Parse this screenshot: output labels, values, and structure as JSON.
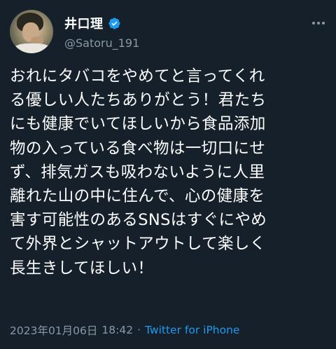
{
  "author": {
    "display_name": "井口理",
    "handle": "@Satoru_191",
    "verified": true,
    "avatar_icon": "profile-photo"
  },
  "tweet": {
    "text": "おれにタバコをやめてと言ってくれ\nる優しい人たちありがとう！君たち\nにも健康でいてほしいから食品添加\n物の入っている食べ物は一切口にせ\nず、排気ガスも吸わないように人里\n離れた山の中に住んで、心の健康を\n害す可能性のあるSNSはすぐにやめ\nて外界とシャットアウトして楽しく\n長生きしてほしい！"
  },
  "meta": {
    "date": "2023年01月06日",
    "time": "18:42",
    "separator": "·",
    "source": "Twitter for iPhone"
  },
  "colors": {
    "background": "#15202b",
    "primary_text": "#ffffff",
    "secondary_text": "#8b98a5",
    "accent": "#1d9bf0"
  },
  "icons": {
    "verified": "verified-badge-icon",
    "more": "more-options-icon"
  }
}
